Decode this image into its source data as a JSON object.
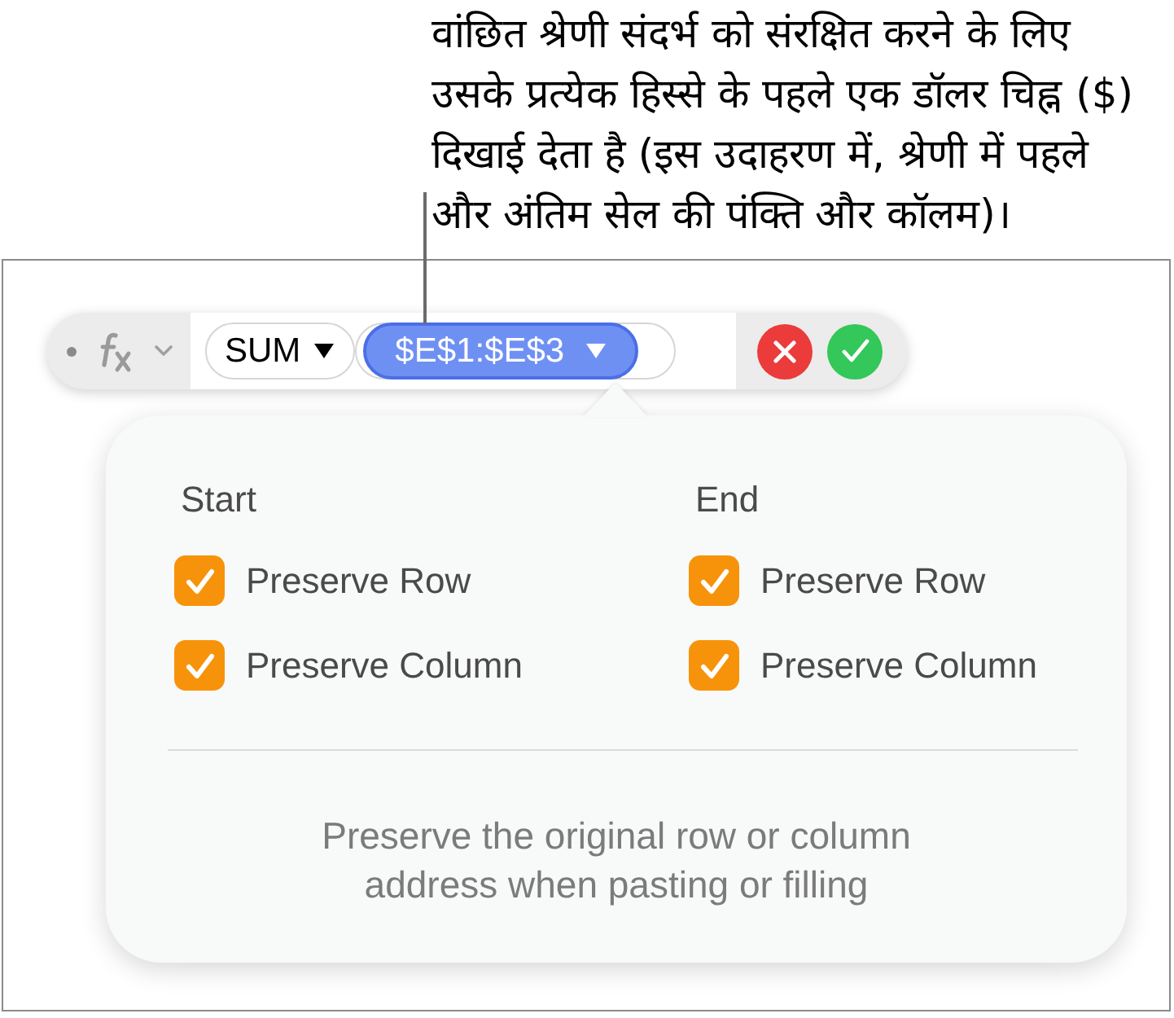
{
  "callout": {
    "text": "वांछित श्रेणी संदर्भ को संरक्षित करने के लिए\nउसके प्रत्येक हिस्से के पहले एक डॉलर चिह्न ($)\nदिखाई देता है (इस उदाहरण में, श्रेणी में पहले\nऔर अंतिम सेल की पंक्ति और कॉलम)।"
  },
  "formula_bar": {
    "tokens": [
      {
        "kind": "function",
        "label": "SUM",
        "selected": false
      },
      {
        "kind": "argument",
        "label": "$E$1:$E$3",
        "selected": true
      }
    ]
  },
  "popover": {
    "groups": [
      {
        "heading": "Start",
        "options": [
          {
            "label": "Preserve Row",
            "checked": true
          },
          {
            "label": "Preserve Column",
            "checked": true
          }
        ]
      },
      {
        "heading": "End",
        "options": [
          {
            "label": "Preserve Row",
            "checked": true
          },
          {
            "label": "Preserve Column",
            "checked": true
          }
        ]
      }
    ],
    "note": "Preserve the original row or column address when pasting or filling"
  }
}
